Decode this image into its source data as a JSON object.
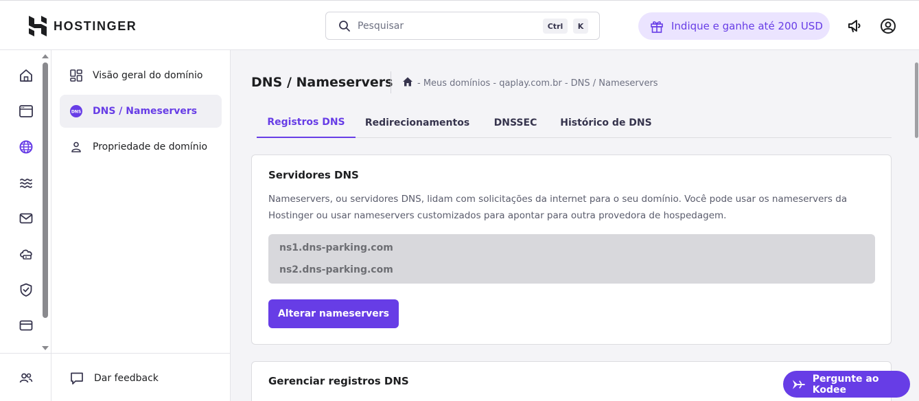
{
  "brand": {
    "name": "HOSTINGER"
  },
  "header": {
    "search": {
      "placeholder": "Pesquisar",
      "shortcut_ctrl": "Ctrl",
      "shortcut_key": "K"
    },
    "promo_label": "Indique e ganhe até 200 USD",
    "icons": [
      "announcement-icon",
      "account-icon"
    ]
  },
  "rail": {
    "items": [
      "home-icon",
      "websites-icon",
      "domains-icon",
      "hosting-icon",
      "email-icon",
      "vps-icon",
      "security-icon",
      "billing-icon"
    ],
    "bottom_item": "team-icon"
  },
  "subnav": {
    "items": [
      {
        "label": "Visão geral do domínio",
        "icon": "dashboard-icon",
        "active": false
      },
      {
        "label": "DNS / Nameservers",
        "icon": "dns-icon",
        "active": true
      },
      {
        "label": "Propriedade de domínio",
        "icon": "person-icon",
        "active": false
      }
    ],
    "feedback_label": "Dar feedback"
  },
  "main": {
    "title": "DNS / Nameservers",
    "breadcrumb": "- Meus domínios - qaplay.com.br - DNS / Nameservers",
    "tabs": [
      {
        "label": "Registros DNS",
        "active": true
      },
      {
        "label": "Redirecionamentos",
        "active": false
      },
      {
        "label": "DNSSEC",
        "active": false
      },
      {
        "label": "Histórico de DNS",
        "active": false
      }
    ],
    "dns_card": {
      "title": "Servidores DNS",
      "description": "Nameservers, ou servidores DNS, lidam com solicitações da internet para o seu domínio. Você pode usar os nameservers da Hostinger ou usar nameservers customizados para apontar para outra provedora de hospedagem.",
      "nameservers": [
        "ns1.dns-parking.com",
        "ns2.dns-parking.com"
      ],
      "button_label": "Alterar nameservers"
    },
    "records_card": {
      "title": "Gerenciar registros DNS"
    }
  },
  "kodee": {
    "label": "Pergunte ao Kodee"
  },
  "colors": {
    "accent": "#673de6",
    "promo_bg": "#ebe4ff",
    "main_bg": "#f4f4f7"
  }
}
